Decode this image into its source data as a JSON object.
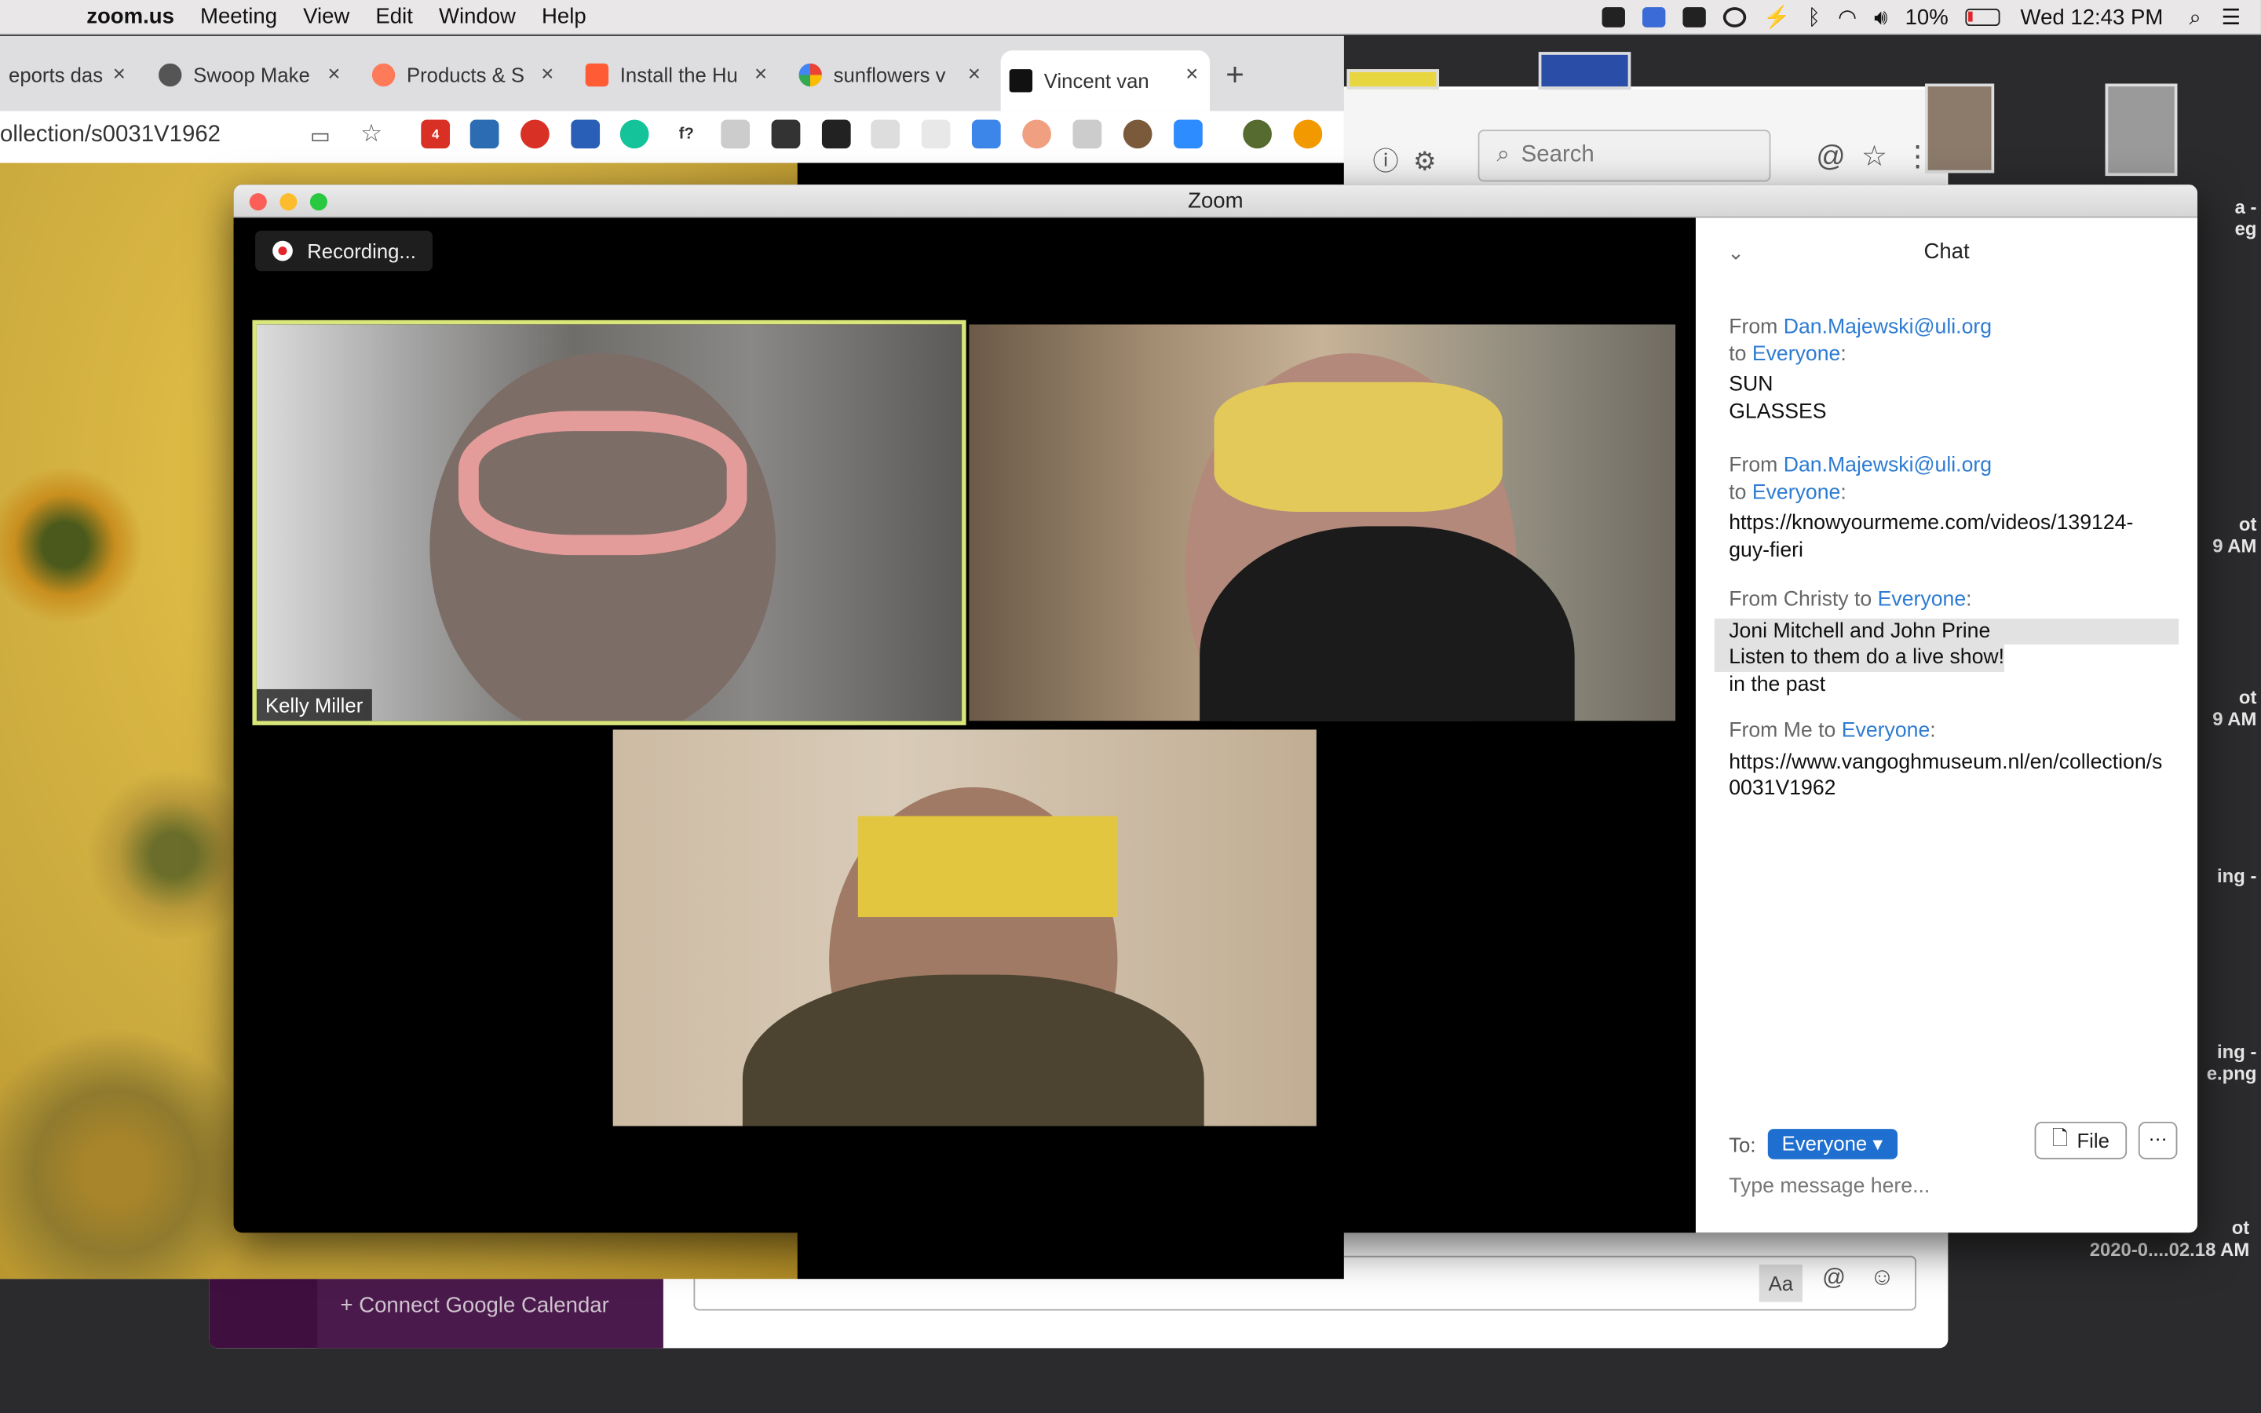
{
  "menubar": {
    "app_name": "zoom.us",
    "items": [
      "Meeting",
      "View",
      "Edit",
      "Window",
      "Help"
    ],
    "battery_pct": "10%",
    "clock": "Wed 12:43 PM"
  },
  "browser": {
    "tabs": [
      {
        "label": "eports das",
        "icon": "reports-favicon"
      },
      {
        "label": "Swoop Make",
        "icon": "globe-icon"
      },
      {
        "label": "Products & S",
        "icon": "hubspot-icon"
      },
      {
        "label": "Install the Hu",
        "icon": "hubspot-install-icon"
      },
      {
        "label": "sunflowers v",
        "icon": "google-icon"
      },
      {
        "label": "Vincent van",
        "icon": "vangogh-museum-icon"
      }
    ],
    "new_tab": "+",
    "url": "ollection/s0031V1962",
    "ext_badge": "4"
  },
  "background_app": {
    "search_placeholder": "Search",
    "connect_calendar": "+ Connect Google Calendar",
    "composer_aa": "Aa",
    "composer_at": "@",
    "desktop_labels": [
      "a -\neg",
      "ot\n9 AM",
      "ot\n9 AM",
      "ing -",
      "ing -\ne.png",
      "ot\n2020-0....02.18 AM"
    ]
  },
  "zoom": {
    "window_title": "Zoom",
    "recording_label": "Recording...",
    "participants": [
      {
        "name": "Kelly Miller",
        "active": true
      },
      {
        "name": ""
      },
      {
        "name": ""
      }
    ],
    "chat": {
      "title": "Chat",
      "messages": [
        {
          "from": "Dan.Majewski@uli.org",
          "to": "Everyone",
          "from_prefix": "From ",
          "to_prefix": "to ",
          "lines": [
            "SUN",
            "GLASSES"
          ]
        },
        {
          "from": "Dan.Majewski@uli.org",
          "to": "Everyone",
          "from_prefix": "From ",
          "to_prefix": "to ",
          "lines": [
            "https://knowyourmeme.com/videos/139124-guy-fieri"
          ]
        },
        {
          "from": "Christy",
          "to": "Everyone",
          "from_prefix": "From ",
          "to_prefix": " to ",
          "lines": [
            "Joni Mitchell and John Prine",
            "Listen to them do a live show!",
            "in the past"
          ]
        },
        {
          "from": "Me",
          "to": "Everyone",
          "from_prefix": "From ",
          "to_prefix": " to ",
          "lines": [
            "https://www.vangoghmuseum.nl/en/collection/s0031V1962"
          ]
        }
      ],
      "to_label": "To:",
      "to_value": "Everyone",
      "file_button": "File",
      "more_button": "···",
      "input_placeholder": "Type message here..."
    }
  },
  "colors": {
    "link": "#2d7bd2",
    "everyone_button": "#1f6fd0",
    "active_speaker_border": "#d8e67a",
    "recording_dot": "#e0262a"
  }
}
